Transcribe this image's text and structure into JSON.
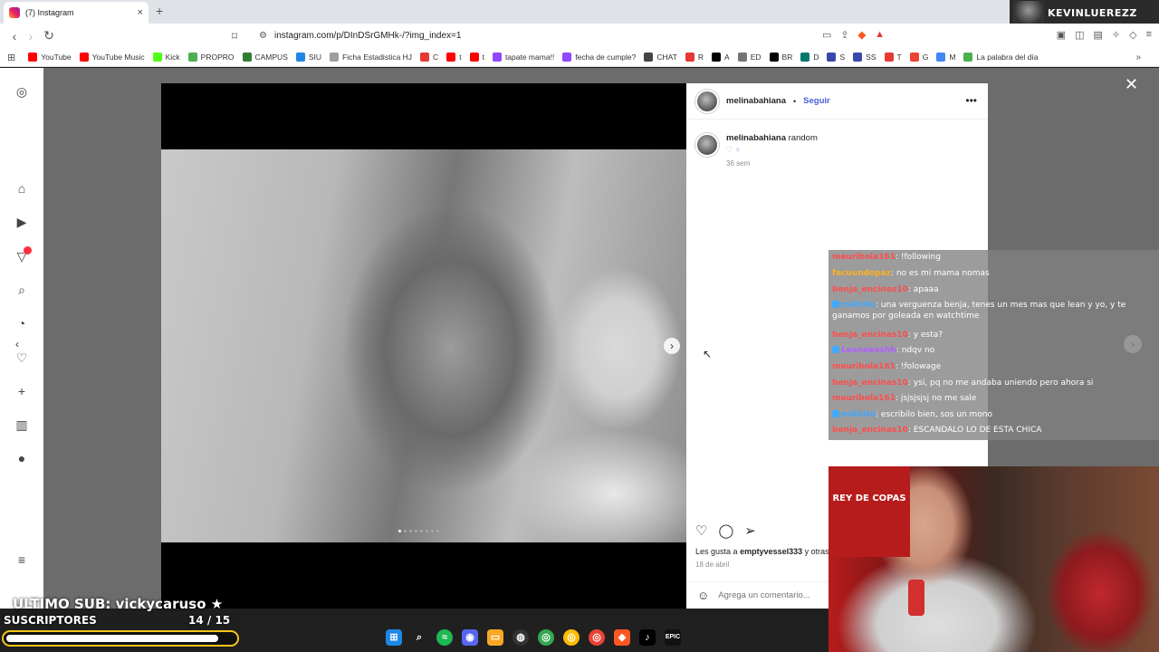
{
  "tab": {
    "title": "(7) Instagram",
    "close": "×",
    "new_tab": "+"
  },
  "streamer_logo": "KEVINLUEREZZ",
  "address": {
    "url": "instagram.com/p/DInDSrGMHk-/?img_index=1"
  },
  "bookmarks": [
    {
      "label": "YouTube",
      "color": "#ff0000"
    },
    {
      "label": "YouTube Music",
      "color": "#ff0000"
    },
    {
      "label": "Kick",
      "color": "#53fc18"
    },
    {
      "label": "PROPRO",
      "color": "#4caf50"
    },
    {
      "label": "CAMPUS",
      "color": "#2e7d32"
    },
    {
      "label": "SIU",
      "color": "#1e88e5"
    },
    {
      "label": "Ficha Estadistica HJ",
      "color": "#9e9e9e"
    },
    {
      "label": "C",
      "color": "#e53935"
    },
    {
      "label": "t",
      "color": "#ff0000"
    },
    {
      "label": "t",
      "color": "#ff0000"
    },
    {
      "label": "tapate mama!!",
      "color": "#9146ff"
    },
    {
      "label": "fecha de cumple?",
      "color": "#9146ff"
    },
    {
      "label": "CHAT",
      "color": "#444444"
    },
    {
      "label": "R",
      "color": "#e53935"
    },
    {
      "label": "A",
      "color": "#000000"
    },
    {
      "label": "ED",
      "color": "#757575"
    },
    {
      "label": "BR",
      "color": "#000000"
    },
    {
      "label": "D",
      "color": "#00796b"
    },
    {
      "label": "S",
      "color": "#3949ab"
    },
    {
      "label": "SS",
      "color": "#3949ab"
    },
    {
      "label": "T",
      "color": "#e53935"
    },
    {
      "label": "G",
      "color": "#ea4335"
    },
    {
      "label": "M",
      "color": "#4285f4"
    },
    {
      "label": "La palabra del día",
      "color": "#4caf50"
    }
  ],
  "post": {
    "username": "melinabahiana",
    "separator": "•",
    "follow": "Seguir",
    "more": "•••",
    "caption_user": "melinabahiana",
    "caption_text": "random",
    "caption_emoji": "♡ ✧",
    "caption_time": "36 sem",
    "likes_prefix": "Les gusta a",
    "likes_user": "emptyvessel333",
    "likes_suffix": "y otras",
    "date": "18 de abril",
    "comment_placeholder": "Agrega un comentario..."
  },
  "chat": [
    {
      "user": "mauribola161",
      "color": "u-red",
      "text": ": !following"
    },
    {
      "user": "facuundopaz",
      "color": "u-orange",
      "text": ": no es mi mama nomas"
    },
    {
      "user": "benja_encinas10",
      "color": "u-red",
      "text": ": apaaa"
    },
    {
      "user": "mikkito",
      "color": "u-blue",
      "text": ": una verguenza benja, tenes un mes mas que lean y yo, y te ganamos por goleada en watchtime"
    },
    {
      "user": "benja_encinas10",
      "color": "u-red",
      "text": ": y esta?"
    },
    {
      "user": "Leaneeeshh",
      "color": "u-purple",
      "text": ": ndqv no"
    },
    {
      "user": "mauribola161",
      "color": "u-red",
      "text": ": !folowage"
    },
    {
      "user": "benja_encinas10",
      "color": "u-red",
      "text": ": ysi, pq no me andaba uniendo pero ahora si"
    },
    {
      "user": "mauribola161",
      "color": "u-red",
      "text": ": jsjsjsjsj no me sale"
    },
    {
      "user": "mikkito",
      "color": "u-blue",
      "text": ": escribilo bien, sos un mono"
    },
    {
      "user": "benja_encinas10",
      "color": "u-red",
      "text": ": ESCANDALO LO DE ESTA CHICA"
    }
  ],
  "webcam": {
    "banner": "REY DE COPAS"
  },
  "overlay": {
    "last_sub": "ULTIMO SUB: vickycaruso ★",
    "subs_label": "SUSCRIPTORES",
    "subs_count": "14  / 15",
    "subs_progress": 0.93
  },
  "colors": {
    "follow": "#4a5ddc",
    "progress_border": "#f5c518"
  }
}
